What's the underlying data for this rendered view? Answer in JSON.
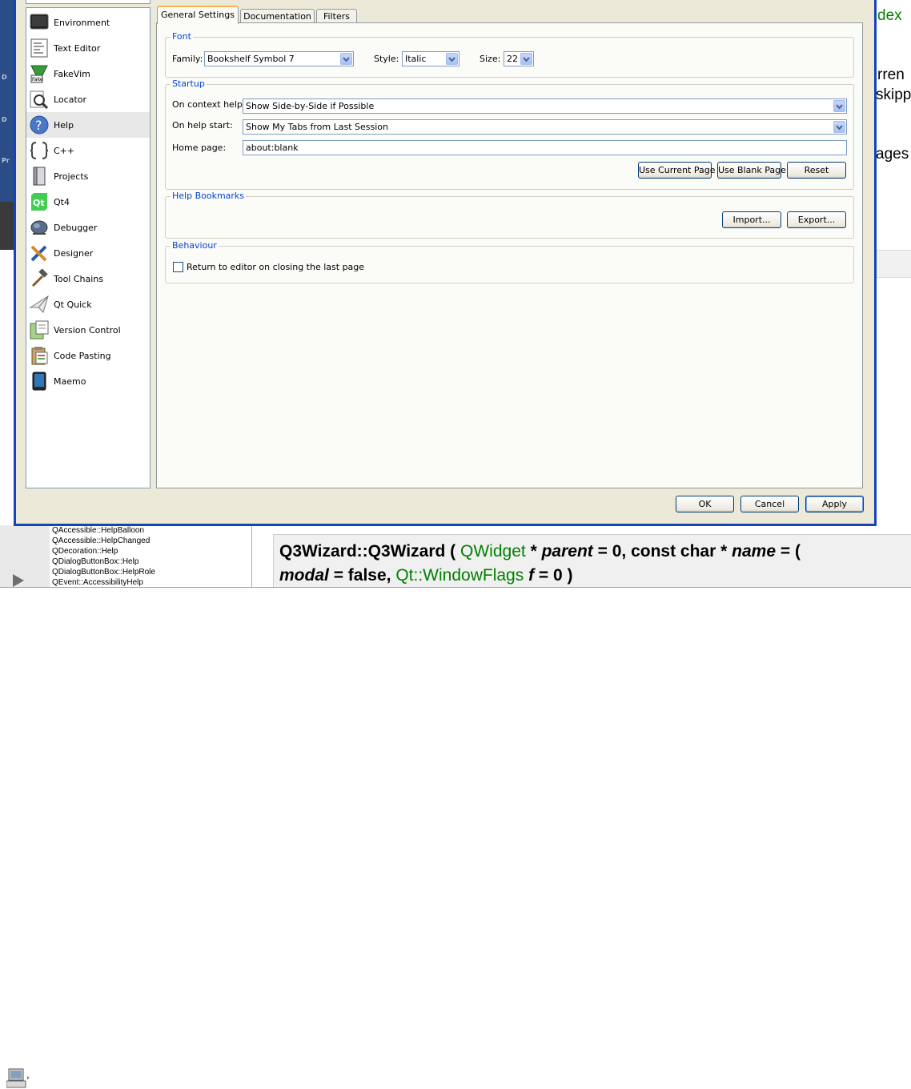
{
  "background": {
    "right_snippets": [
      "dex",
      "rren",
      "skipp",
      "ages"
    ],
    "index_list": [
      "QAccessible::HelpBalloon",
      "QAccessible::HelpChanged",
      "QDecoration::Help",
      "QDialogButtonBox::Help",
      "QDialogButtonBox::HelpRole",
      "QEvent::AccessibilityHelp"
    ],
    "doc_signature": {
      "line1": {
        "func": "Q3Wizard::Q3Wizard",
        "open": "(",
        "type1": "QWidget",
        "ptr1": "*",
        "param1": "parent",
        "def1": "= 0,  const char",
        "ptr2": "*",
        "param2": "name",
        "def2": "= ("
      },
      "line2": {
        "param3": "modal",
        "def3": "= false,",
        "type2": "Qt::WindowFlags",
        "param4": "f",
        "def4": "= 0 )"
      }
    }
  },
  "sidebar": {
    "selected": "Help",
    "items": [
      {
        "label": "Environment",
        "icon": "monitor-icon"
      },
      {
        "label": "Text Editor",
        "icon": "text-editor-icon"
      },
      {
        "label": "FakeVim",
        "icon": "fakevim-icon"
      },
      {
        "label": "Locator",
        "icon": "locator-icon"
      },
      {
        "label": "Help",
        "icon": "help-icon"
      },
      {
        "label": "C++",
        "icon": "cpp-icon"
      },
      {
        "label": "Projects",
        "icon": "projects-icon"
      },
      {
        "label": "Qt4",
        "icon": "qt4-icon"
      },
      {
        "label": "Debugger",
        "icon": "debugger-icon"
      },
      {
        "label": "Designer",
        "icon": "designer-icon"
      },
      {
        "label": "Tool Chains",
        "icon": "tool-chains-icon"
      },
      {
        "label": "Qt Quick",
        "icon": "qt-quick-icon"
      },
      {
        "label": "Version Control",
        "icon": "version-control-icon"
      },
      {
        "label": "Code Pasting",
        "icon": "code-pasting-icon"
      },
      {
        "label": "Maemo",
        "icon": "maemo-icon"
      }
    ]
  },
  "tabs": [
    {
      "label": "General Settings",
      "active": true
    },
    {
      "label": "Documentation",
      "active": false
    },
    {
      "label": "Filters",
      "active": false
    }
  ],
  "font_group": {
    "title": "Font",
    "family_label": "Family:",
    "family_value": "Bookshelf Symbol 7",
    "style_label": "Style:",
    "style_value": "Italic",
    "size_label": "Size:",
    "size_value": "22"
  },
  "startup_group": {
    "title": "Startup",
    "context_help_label": "On context help:",
    "context_help_value": "Show Side-by-Side if Possible",
    "help_start_label": "On help start:",
    "help_start_value": "Show My Tabs from Last Session",
    "home_page_label": "Home page:",
    "home_page_value": "about:blank",
    "use_current_page": "Use Current Page",
    "use_blank_page": "Use Blank Page",
    "reset": "Reset"
  },
  "bookmarks_group": {
    "title": "Help Bookmarks",
    "import": "Import...",
    "export": "Export..."
  },
  "behaviour_group": {
    "title": "Behaviour",
    "return_to_editor": "Return to editor on closing the last page",
    "return_to_editor_checked": false
  },
  "footer": {
    "ok": "OK",
    "cancel": "Cancel",
    "apply": "Apply"
  },
  "colors": {
    "dialog_frame": "#1543b8",
    "dialog_bg": "#ece9d8",
    "group_title": "#0046d5",
    "active_tab_accent": "#f9b24e",
    "doc_green": "#008000"
  }
}
